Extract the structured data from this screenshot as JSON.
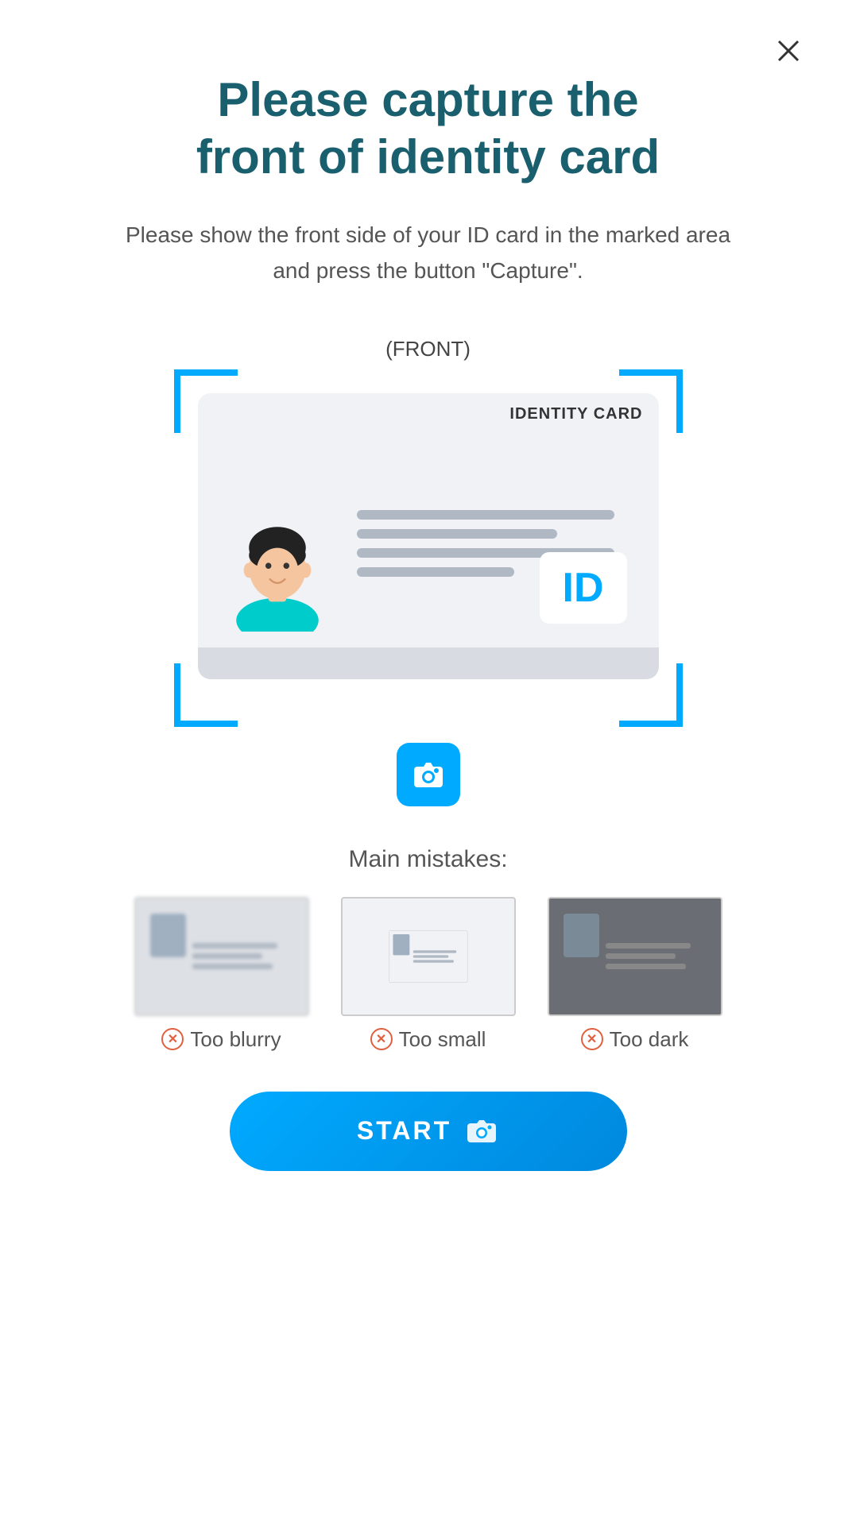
{
  "page": {
    "title_line1": "Please capture the",
    "title_line2": "front of identity card",
    "subtitle": "Please show the front side of your ID card in the marked area and press the button \"Capture\".",
    "front_label": "(FRONT)",
    "id_card_label": "IDENTITY CARD",
    "id_badge": "ID",
    "mistakes_title": "Main mistakes:",
    "mistakes": [
      {
        "label": "Too blurry",
        "type": "blurry"
      },
      {
        "label": "Too small",
        "type": "small"
      },
      {
        "label": "Too dark",
        "type": "dark"
      }
    ],
    "start_button": "START",
    "close_label": "Close"
  }
}
